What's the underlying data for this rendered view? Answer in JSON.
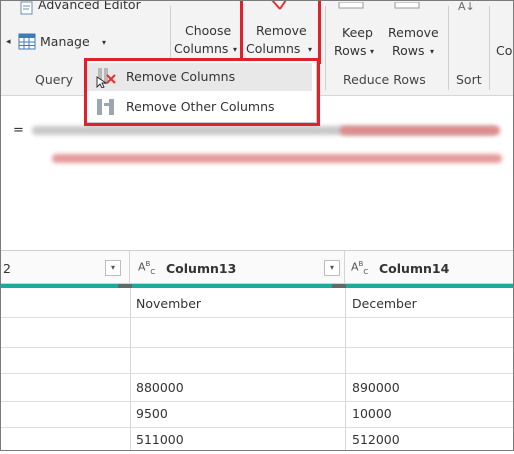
{
  "ribbon": {
    "advanced_editor": "Advanced Editor",
    "manage": "Manage",
    "query_group": "Query",
    "choose_line1": "Choose",
    "choose_line2": "Columns",
    "remove_line1": "Remove",
    "remove_line2": "Columns",
    "keep_line1": "Keep",
    "keep_line2": "Rows",
    "removerows_line1": "Remove",
    "removerows_line2": "Rows",
    "reduce_rows_group": "Reduce Rows",
    "sort_group": "Sort",
    "cut_off_label": "Co",
    "sort_icon": "A↓",
    "caret": "▾",
    "colors": {
      "highlight": "#e0202a",
      "teal": "#1aab9b"
    }
  },
  "menu": {
    "items": [
      {
        "label": "Remove Columns",
        "icon": "remove-columns-icon"
      },
      {
        "label": "Remove Other Columns",
        "icon": "remove-other-columns-icon"
      }
    ]
  },
  "formula": {
    "eq": "="
  },
  "grid": {
    "partial_header": "2",
    "type_prefix": "A",
    "type_sup": "B",
    "type_sub": "C",
    "columns": [
      "Column13",
      "Column14"
    ],
    "rows": [
      [
        "November",
        "December"
      ],
      [
        "",
        ""
      ],
      [
        "",
        ""
      ],
      [
        "880000",
        "890000"
      ],
      [
        "9500",
        "10000"
      ],
      [
        "511000",
        "512000"
      ]
    ]
  }
}
